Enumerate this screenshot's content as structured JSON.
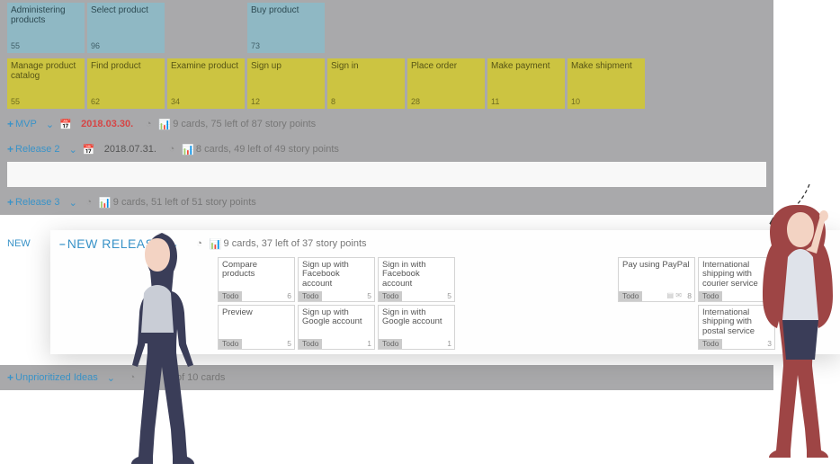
{
  "top_rows": [
    [
      {
        "title": "Administering products",
        "num": "55",
        "cls": "card-blue"
      },
      {
        "title": "Select product",
        "num": "96",
        "cls": "card-blue"
      },
      null,
      {
        "title": "Buy product",
        "num": "73",
        "cls": "card-blue"
      }
    ],
    [
      {
        "title": "Manage product catalog",
        "num": "55",
        "cls": "card-yellow"
      },
      {
        "title": "Find product",
        "num": "62",
        "cls": "card-yellow"
      },
      {
        "title": "Examine product",
        "num": "34",
        "cls": "card-yellow"
      },
      {
        "title": "Sign up",
        "num": "12",
        "cls": "card-yellow"
      },
      {
        "title": "Sign in",
        "num": "8",
        "cls": "card-yellow"
      },
      {
        "title": "Place order",
        "num": "28",
        "cls": "card-yellow"
      },
      {
        "title": "Make payment",
        "num": "11",
        "cls": "card-yellow"
      },
      {
        "title": "Make shipment",
        "num": "10",
        "cls": "card-yellow"
      }
    ]
  ],
  "releases": [
    {
      "toggle": "+",
      "name": "MVP",
      "date": "2018.03.30.",
      "dateRed": true,
      "calBlue": true,
      "stats": "9 cards, 75 left of 87 story points"
    },
    {
      "toggle": "+",
      "name": "Release 2",
      "date": "2018.07.31.",
      "dateRed": false,
      "calBlue": false,
      "stats": "8 cards, 49 left of 49 story points"
    },
    {
      "toggle": "+",
      "name": "Release 3",
      "stats": "9 cards, 51 left of 51 story points"
    }
  ],
  "newlabel": "NEW",
  "new_release": {
    "toggle": "–",
    "title": "NEW RELEASE",
    "stats": "9 cards, 37 left of 37 story points",
    "rows": [
      [
        {
          "skip": 2
        },
        {
          "title": "Compare products",
          "status": "Todo",
          "num": "6"
        },
        {
          "title": "Sign up with Facebook account",
          "status": "Todo",
          "num": "5"
        },
        {
          "title": "Sign in with Facebook account",
          "status": "Todo",
          "num": "5"
        },
        {
          "skip": 2
        },
        {
          "title": "Pay using PayPal",
          "status": "Todo",
          "num": "8",
          "extra": true
        },
        {
          "title": "International shipping with courier service",
          "status": "Todo",
          "num": "3"
        }
      ],
      [
        {
          "skip": 2
        },
        {
          "title": "Preview",
          "status": "Todo",
          "num": "5"
        },
        {
          "title": "Sign up with Google account",
          "status": "Todo",
          "num": "1"
        },
        {
          "title": "Sign in with Google account",
          "status": "Todo",
          "num": "1"
        },
        {
          "skip": 3
        },
        {
          "title": "International shipping with postal service",
          "status": "Todo",
          "num": "3"
        }
      ]
    ]
  },
  "unprio": {
    "toggle": "+",
    "name": "Unprioritized Ideas",
    "stats": "of 10 cards"
  }
}
